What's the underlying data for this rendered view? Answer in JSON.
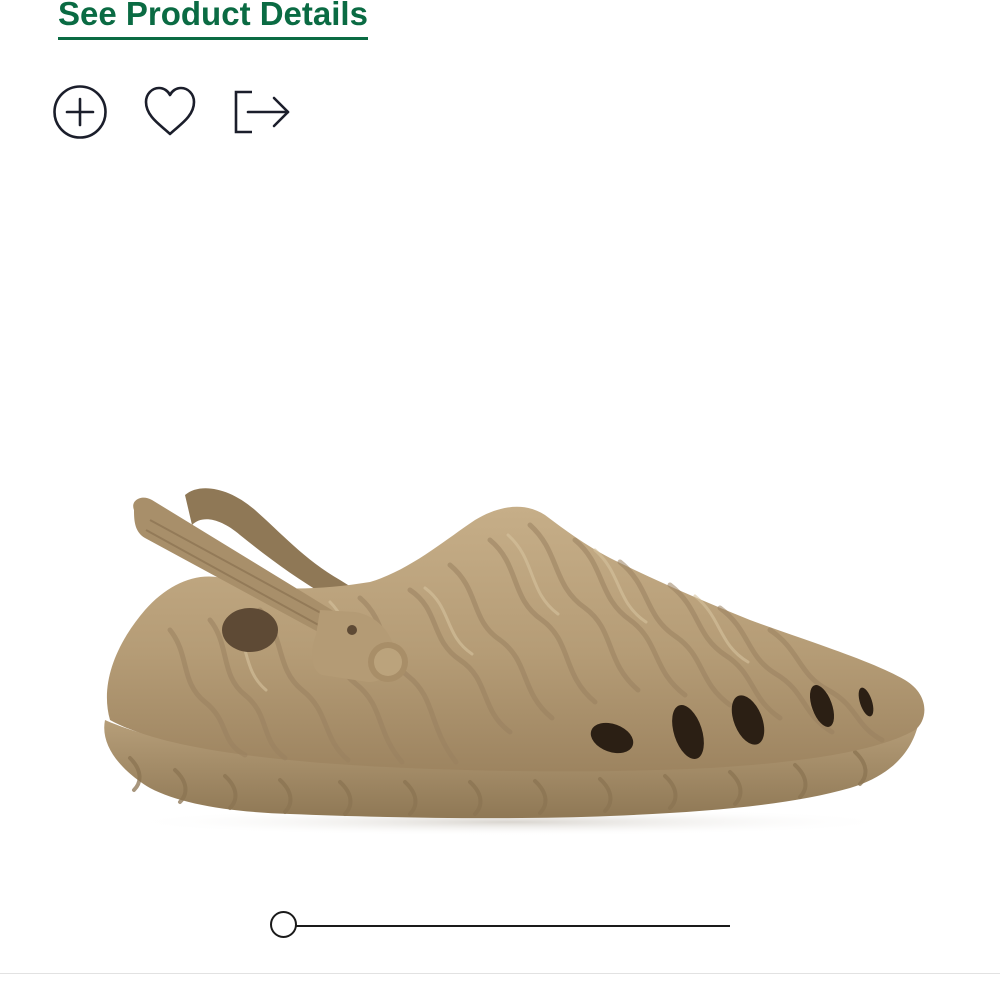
{
  "product_details": {
    "link_label": "See Product Details",
    "link_color": "#0a6b43"
  },
  "actions": {
    "items": [
      {
        "icon": "plus-circle-icon",
        "name": "add-to-portfolio"
      },
      {
        "icon": "heart-icon",
        "name": "add-to-favorites"
      },
      {
        "icon": "share-icon",
        "name": "share"
      }
    ],
    "icon_color": "#1b1e2b"
  },
  "product_image": {
    "icon": "clog-shoe-image",
    "colors": {
      "base": "#b8a07b",
      "shadow": "#8c7555",
      "highlight": "#cdb893",
      "hole": "#2b1f14",
      "strap": "#a88f6a"
    }
  },
  "image_slider": {
    "position_fraction": 0.0
  }
}
